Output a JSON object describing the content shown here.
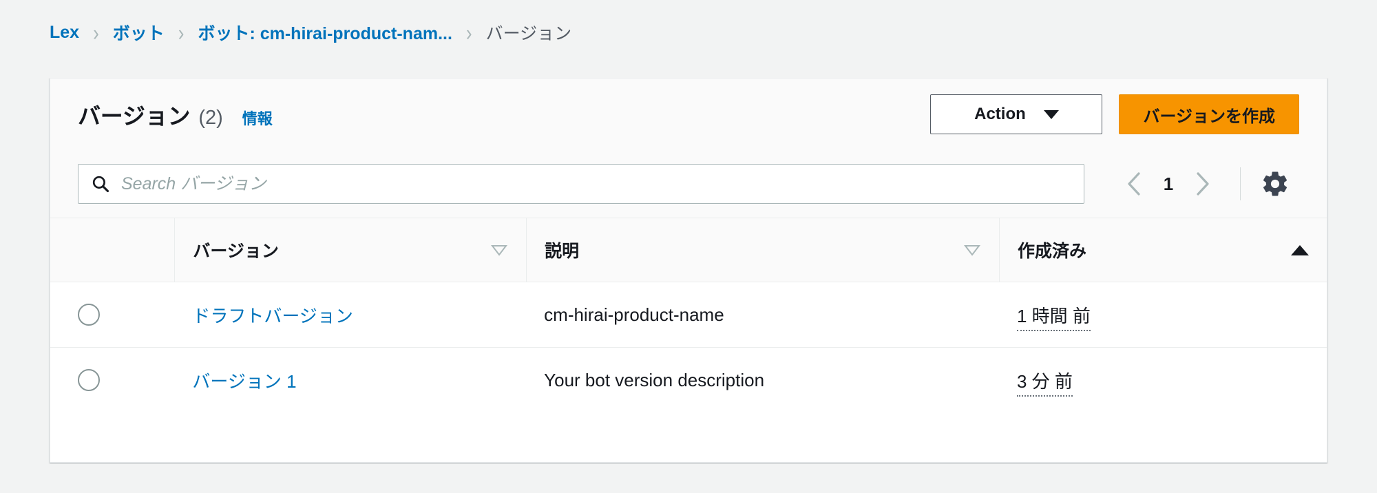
{
  "breadcrumb": {
    "separator": "›",
    "items": [
      {
        "label": "Lex",
        "current": false
      },
      {
        "label": "ボット",
        "current": false
      },
      {
        "label": "ボット: cm-hirai-product-nam...",
        "current": false
      },
      {
        "label": "バージョン",
        "current": true
      }
    ]
  },
  "panel": {
    "title": "バージョン",
    "count": "(2)",
    "info_link": "情報",
    "action_button": "Action",
    "action_caret_icon": "chevron-down-icon",
    "create_button": "バージョンを作成"
  },
  "search": {
    "icon": "search-icon",
    "placeholder": "Search バージョン",
    "value": ""
  },
  "pagination": {
    "prev_icon": "chevron-left-icon",
    "next_icon": "chevron-right-icon",
    "page": "1",
    "settings_icon": "gear-icon"
  },
  "table": {
    "columns": [
      {
        "key": "select",
        "label": "",
        "sort": "none"
      },
      {
        "key": "version",
        "label": "バージョン",
        "sort": "idle",
        "sort_icon": "sort-descending-icon"
      },
      {
        "key": "description",
        "label": "説明",
        "sort": "idle",
        "sort_icon": "sort-descending-icon"
      },
      {
        "key": "created",
        "label": "作成済み",
        "sort": "ascending",
        "sort_icon": "sort-ascending-icon"
      }
    ],
    "rows": [
      {
        "radio_icon": "radio-unchecked-icon",
        "version": "ドラフトバージョン",
        "description": "cm-hirai-product-name",
        "created": "1 時間 前"
      },
      {
        "radio_icon": "radio-unchecked-icon",
        "version": "バージョン 1",
        "description": "Your bot version description",
        "created": "3 分 前"
      }
    ]
  },
  "colors": {
    "page_background": "#f2f3f3",
    "link": "#0073bb",
    "primary_button": "#f79400",
    "text": "#16191f",
    "muted_text": "#545b64",
    "border": "#eaeded"
  }
}
